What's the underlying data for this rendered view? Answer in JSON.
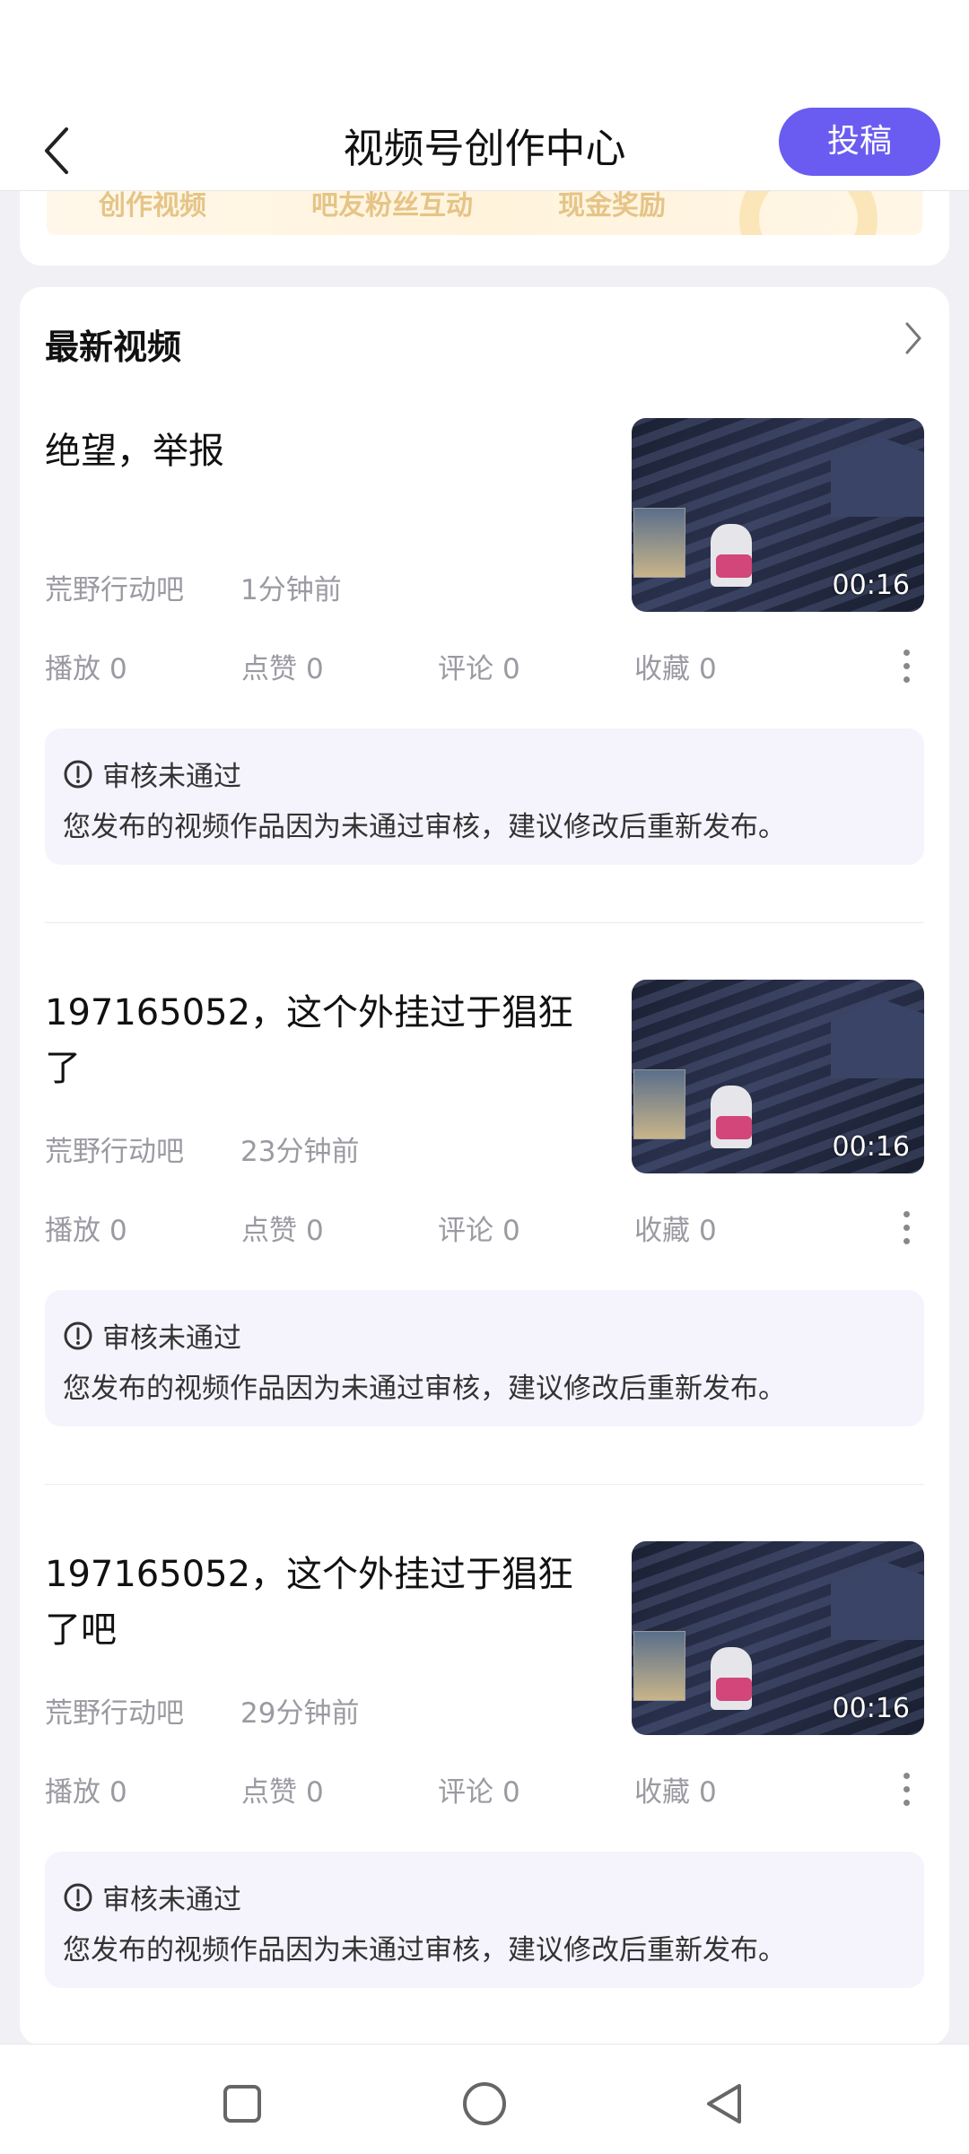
{
  "header": {
    "title": "视频号创作中心",
    "submit_label": "投稿"
  },
  "banner": {
    "items": [
      "创作视频",
      "吧友粉丝互动",
      "现金奖励"
    ]
  },
  "section": {
    "title": "最新视频"
  },
  "videos": [
    {
      "title": "绝望，举报",
      "source": "荒野行动吧",
      "time": "1分钟前",
      "duration": "00:16",
      "stats": {
        "play_label": "播放",
        "play": "0",
        "like_label": "点赞",
        "like": "0",
        "comment_label": "评论",
        "comment": "0",
        "fav_label": "收藏",
        "fav": "0"
      },
      "review_title": "审核未通过",
      "review_desc": "您发布的视频作品因为未通过审核，建议修改后重新发布。"
    },
    {
      "title": "197165052，这个外挂过于猖狂了",
      "source": "荒野行动吧",
      "time": "23分钟前",
      "duration": "00:16",
      "stats": {
        "play_label": "播放",
        "play": "0",
        "like_label": "点赞",
        "like": "0",
        "comment_label": "评论",
        "comment": "0",
        "fav_label": "收藏",
        "fav": "0"
      },
      "review_title": "审核未通过",
      "review_desc": "您发布的视频作品因为未通过审核，建议修改后重新发布。"
    },
    {
      "title": "197165052，这个外挂过于猖狂了吧",
      "source": "荒野行动吧",
      "time": "29分钟前",
      "duration": "00:16",
      "stats": {
        "play_label": "播放",
        "play": "0",
        "like_label": "点赞",
        "like": "0",
        "comment_label": "评论",
        "comment": "0",
        "fav_label": "收藏",
        "fav": "0"
      },
      "review_title": "审核未通过",
      "review_desc": "您发布的视频作品因为未通过审核，建议修改后重新发布。"
    }
  ],
  "colors": {
    "accent": "#6a5cf0",
    "review_bg": "#f5f4fd"
  },
  "icons": [
    "back-arrow-icon",
    "chevron-right-icon",
    "more-vertical-icon",
    "alert-circle-icon",
    "recent-apps-icon",
    "home-icon",
    "back-triangle-icon"
  ]
}
